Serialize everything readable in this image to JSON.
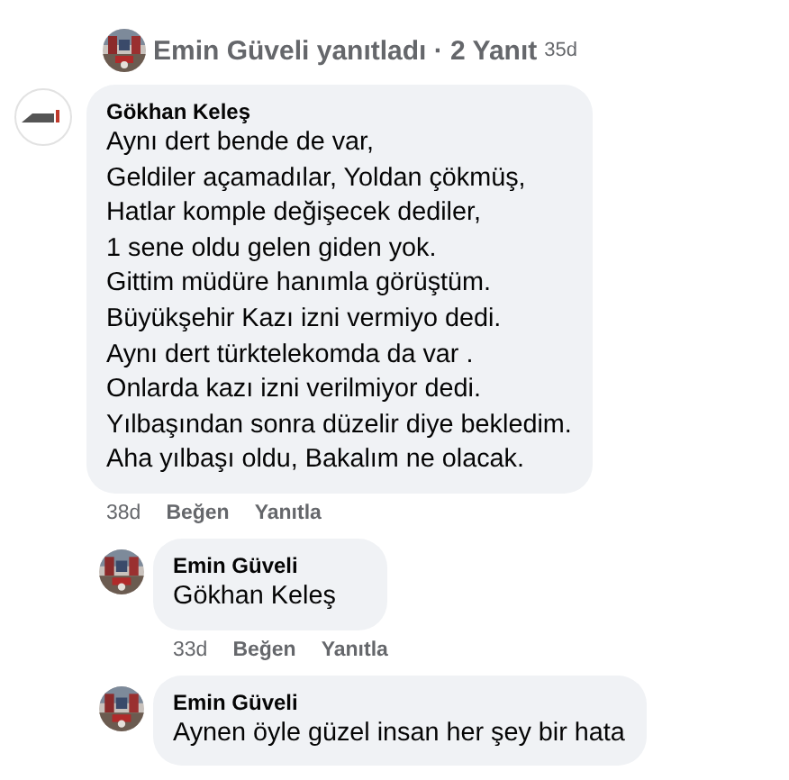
{
  "reply_summary": {
    "text": "Emin Güveli yanıtladı · 2 Yanıt",
    "time": "35d"
  },
  "comment": {
    "author": "Gökhan Keleş",
    "text": "Aynı dert bende de var,\nGeldiler açamadılar, Yoldan çökmüş,\nHatlar komple değişecek dediler,\n1 sene oldu gelen giden yok.\nGittim müdüre hanımla görüştüm.\nBüyükşehir Kazı izni vermiyo dedi.\nAynı dert türktelekomda da var .\nOnlarda kazı izni verilmiyor dedi.\nYılbaşından sonra düzelir diye bekledim.\nAha yılbaşı oldu, Bakalım ne olacak.",
    "time": "38d",
    "actions": [
      "Beğen",
      "Yanıtla"
    ]
  },
  "replies": [
    {
      "author": "Emin Güveli",
      "text": "Gökhan Keleş",
      "time": "33d",
      "actions": [
        "Beğen",
        "Yanıtla"
      ]
    },
    {
      "author": "Emin Güveli",
      "text": "Aynen öyle güzel insan her şey bir hata"
    }
  ]
}
